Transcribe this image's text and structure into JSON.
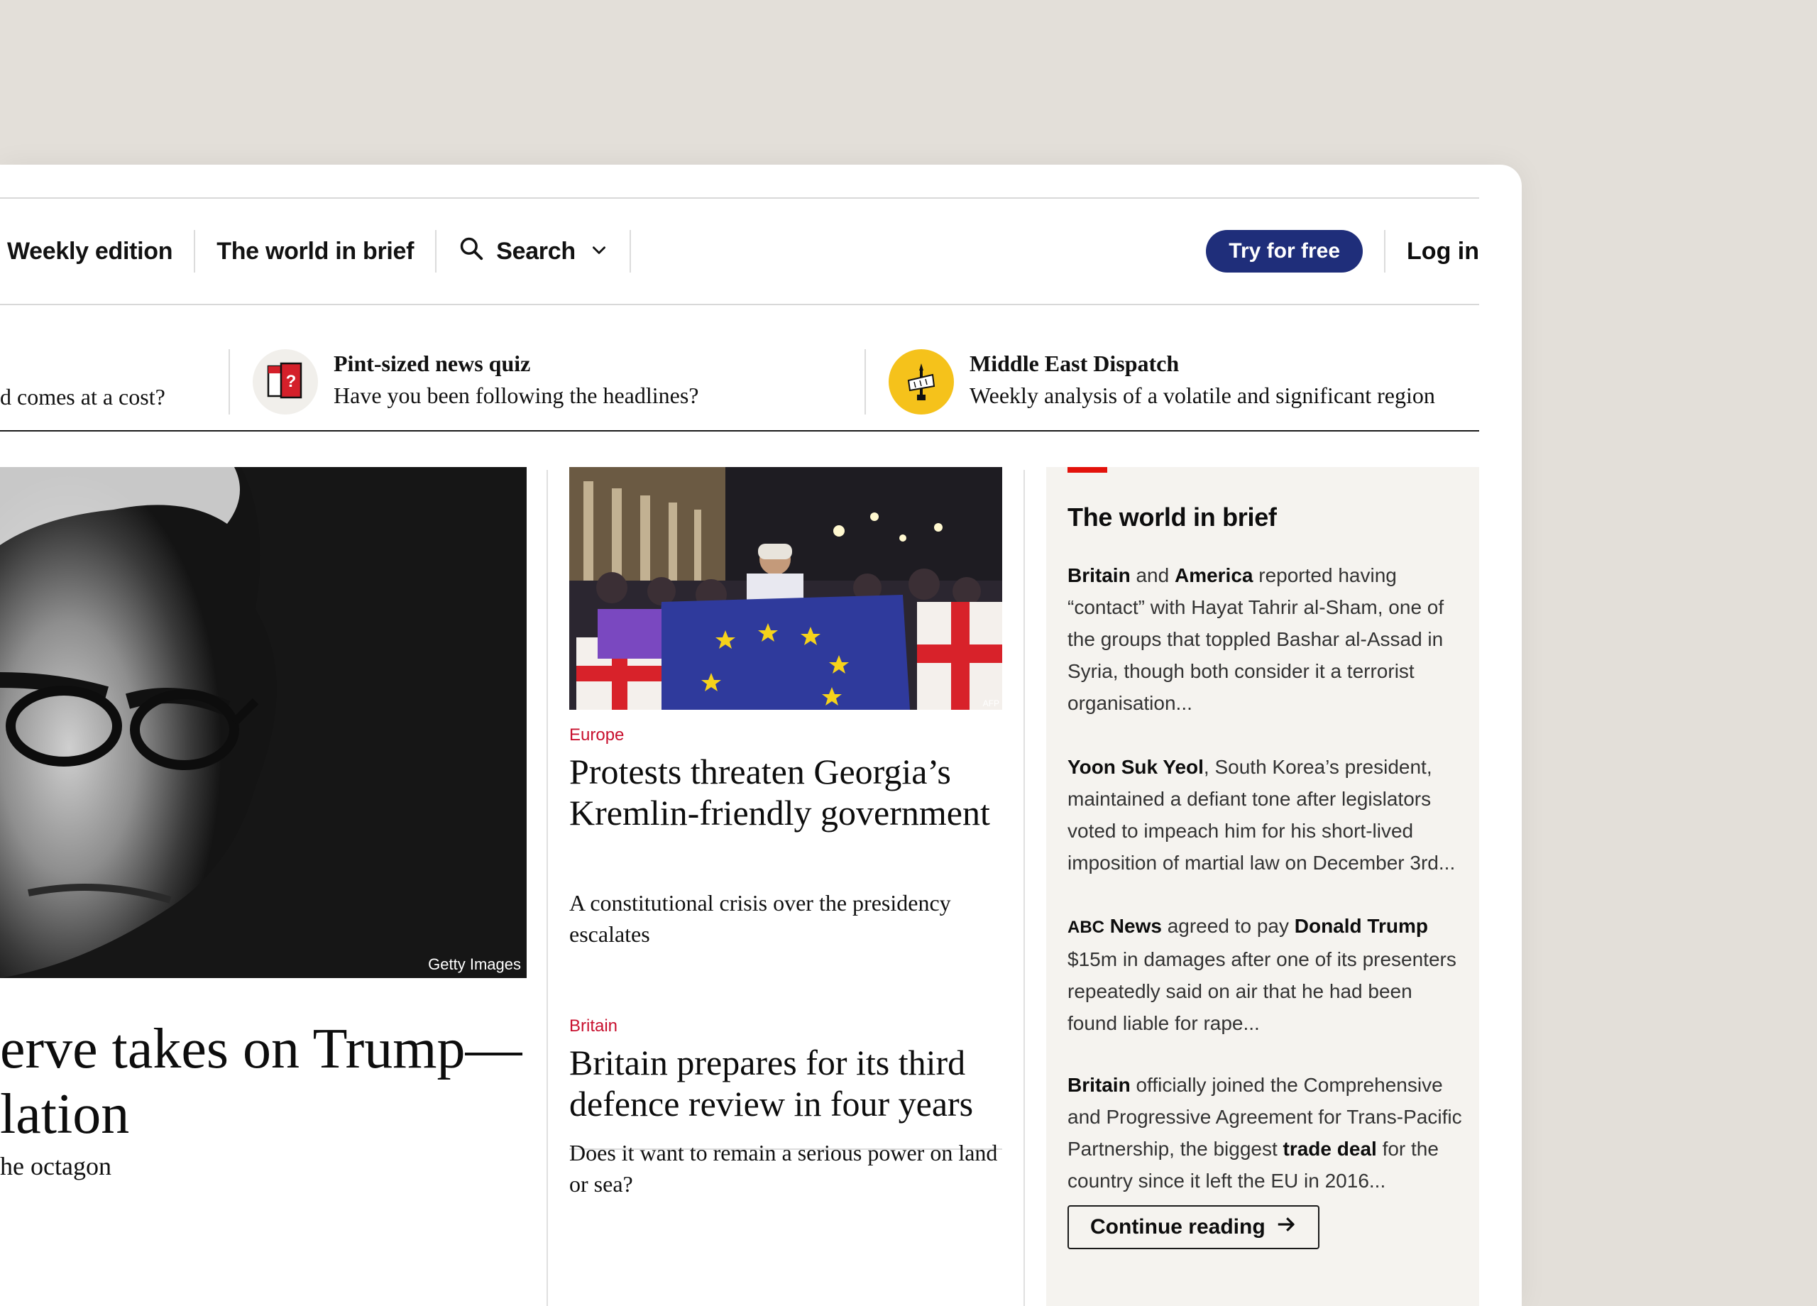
{
  "nav": {
    "weekly_edition": "Weekly edition",
    "world_in_brief": "The world in brief",
    "search": "Search",
    "try_free": "Try for free",
    "log_in": "Log in"
  },
  "promos": {
    "partial_sub": "d comes at a cost?",
    "quiz_title": "Pint-sized news quiz",
    "quiz_sub": "Have you been following the headlines?",
    "dispatch_title": "Middle East Dispatch",
    "dispatch_sub": "Weekly analysis of a volatile and significant region"
  },
  "lead": {
    "credit": "Getty Images",
    "headline_line1": "erve takes on Trump—",
    "headline_line2": "lation",
    "sub": "he octagon"
  },
  "story1": {
    "section": "Europe",
    "headline": "Protests threaten Georgia’s Kremlin-friendly government",
    "sub": "A constitutional crisis over the presidency escalates",
    "credit": "AFP"
  },
  "story2": {
    "section": "Britain",
    "headline": "Britain prepares for its third defence review in four years",
    "sub": "Does it want to remain a serious power on land or sea?"
  },
  "brief": {
    "title": "The world in brief",
    "item1": {
      "b1": "Britain",
      "t1": " and ",
      "b2": "America",
      "t2": " reported having “contact” with Hayat Tahrir al-Sham, one of the groups that toppled Bashar al-Assad in Syria, though both consider it a terrorist organisation..."
    },
    "item2": {
      "b1": "Yoon Suk Yeol",
      "t1": ", South Korea’s president, maintained a defiant tone after legislators voted to impeach him for his short-lived imposition of martial law on December 3rd..."
    },
    "item3": {
      "abc": "ABC",
      "b1": " News",
      "t1": " agreed to pay ",
      "b2": "Donald Trump",
      "t2": " $15m in damages after one of its presenters repeatedly said on air that he had been found liable for rape..."
    },
    "item4": {
      "b1": "Britain",
      "t1": " officially joined the Comprehensive and Progressive Agreement for Trans-Pacific Partnership, the biggest ",
      "b2": "trade deal",
      "t2": " for the country since it left the EU in 2016..."
    },
    "continue": "Continue reading"
  },
  "colors": {
    "accent_blue": "#1f2e7a",
    "section_red": "#c8102e",
    "brief_bar": "#e3120b",
    "dispatch_icon": "#f5c21b"
  }
}
